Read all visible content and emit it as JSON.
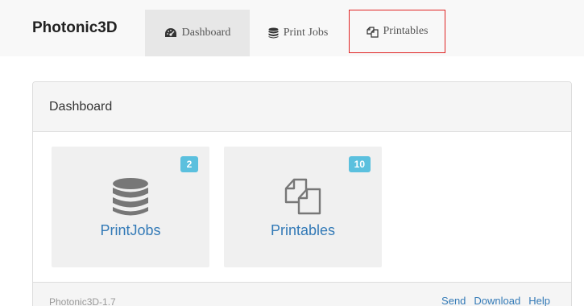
{
  "navbar": {
    "brand": "Photonic3D",
    "tabs": [
      {
        "label": "Dashboard",
        "icon": "tachometer-icon",
        "active": true
      },
      {
        "label": "Print Jobs",
        "icon": "database-icon",
        "active": false
      },
      {
        "label": "Printables",
        "icon": "files-icon",
        "active": false,
        "highlighted": true
      }
    ]
  },
  "panel": {
    "heading": "Dashboard",
    "tiles": [
      {
        "label": "PrintJobs",
        "count": "2",
        "icon": "database-icon"
      },
      {
        "label": "Printables",
        "count": "10",
        "icon": "files-icon"
      }
    ],
    "footer": {
      "version": "Photonic3D-1.7",
      "links": [
        "Send",
        "Download",
        "Help"
      ]
    }
  },
  "colors": {
    "link": "#337ab7",
    "badge": "#5bc0de",
    "highlight_border": "#e02424"
  }
}
